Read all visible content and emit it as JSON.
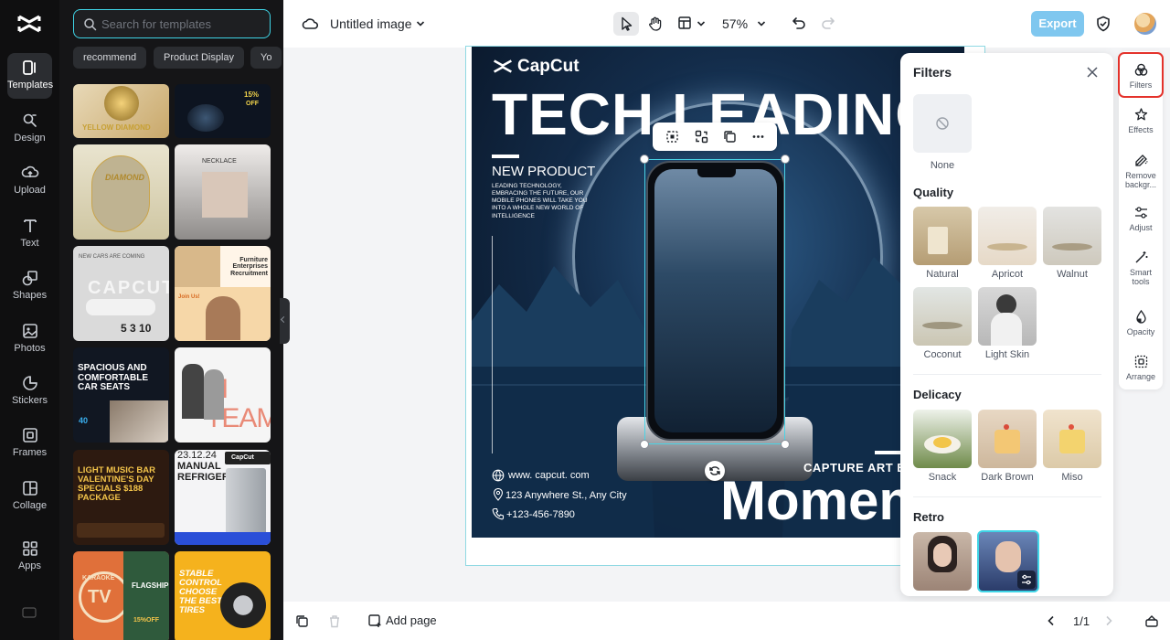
{
  "sidebar": {
    "items": [
      {
        "label": "Templates",
        "icon": "templates-icon"
      },
      {
        "label": "Design",
        "icon": "design-icon"
      },
      {
        "label": "Upload",
        "icon": "upload-icon"
      },
      {
        "label": "Text",
        "icon": "text-icon"
      },
      {
        "label": "Shapes",
        "icon": "shapes-icon"
      },
      {
        "label": "Photos",
        "icon": "photos-icon"
      },
      {
        "label": "Stickers",
        "icon": "stickers-icon"
      },
      {
        "label": "Frames",
        "icon": "frames-icon"
      },
      {
        "label": "Collage",
        "icon": "collage-icon"
      },
      {
        "label": "Apps",
        "icon": "apps-icon"
      }
    ]
  },
  "templates_panel": {
    "search_placeholder": "Search for templates",
    "chips": [
      "recommend",
      "Product Display",
      "Yo"
    ],
    "thumbs": {
      "t1": "YELLOW DIAMOND",
      "t2a": "15%",
      "t2b": "OFF",
      "t3": "DIAMOND",
      "t4": "NECKLACE",
      "t5a": "NEW CARS ARE COMING",
      "t5b": "CAPCUT",
      "t5c": "5  3  10",
      "t6a": "Furniture Enterprises Recruitment",
      "t6b": "Join Us!",
      "t7": "SPACIOUS AND COMFORTABLE CAR SEATS",
      "t7b": "40",
      "t8": "M TEAM",
      "t9": "LIGHT MUSIC BAR VALENTINE'S DAY SPECIALS $188 PACKAGE",
      "t10a": "23.12.24",
      "t10b": "MANUAL REFRIGERATOR",
      "t10c": "CapCut",
      "t11a": "KARAOKE",
      "t11b": "TV",
      "t11c": "FLAGSHIP",
      "t11d": "15%OFF",
      "t12": "STABLE CONTROL CHOOSE THE BEST TIRES"
    }
  },
  "topbar": {
    "doc_title": "Untitled image",
    "zoom": "57%",
    "export_label": "Export"
  },
  "poster": {
    "brand": "CapCut",
    "headline": "TECH LEADING",
    "subhead": "NEW PRODUCT",
    "body": "LEADING TECHNOLOGY, EMBRACING THE FUTURE, OUR MOBILE PHONES WILL TAKE YOU INTO A WHOLE NEW WORLD OF INTELLIGENCE",
    "website": "www. capcut. com",
    "address": "123 Anywhere St., Any City",
    "phone": "+123-456-7890",
    "capture": "CAPTURE ART  E",
    "moment": "Momen"
  },
  "filters": {
    "title": "Filters",
    "none_label": "None",
    "sections": {
      "quality": "Quality",
      "delicacy": "Delicacy",
      "retro": "Retro"
    },
    "quality_items": [
      "Natural",
      "Apricot",
      "Walnut",
      "Coconut",
      "Light Skin"
    ],
    "delicacy_items": [
      "Snack",
      "Dark Brown",
      "Miso"
    ]
  },
  "tools": {
    "items": [
      {
        "label": "Filters",
        "icon": "filters-icon"
      },
      {
        "label": "Effects",
        "icon": "effects-icon"
      },
      {
        "label": "Remove backgr...",
        "icon": "remove-background-icon"
      },
      {
        "label": "Adjust",
        "icon": "adjust-icon"
      },
      {
        "label": "Smart tools",
        "icon": "smart-tools-icon"
      },
      {
        "label": "Opacity",
        "icon": "opacity-icon"
      },
      {
        "label": "Arrange",
        "icon": "arrange-icon"
      }
    ]
  },
  "bottombar": {
    "add_page": "Add page",
    "page_count": "1/1"
  },
  "colors": {
    "accent": "#3fd4e6",
    "export": "#7fc7ef",
    "highlight": "#e4322b",
    "rail_bg": "#0f0f10"
  }
}
